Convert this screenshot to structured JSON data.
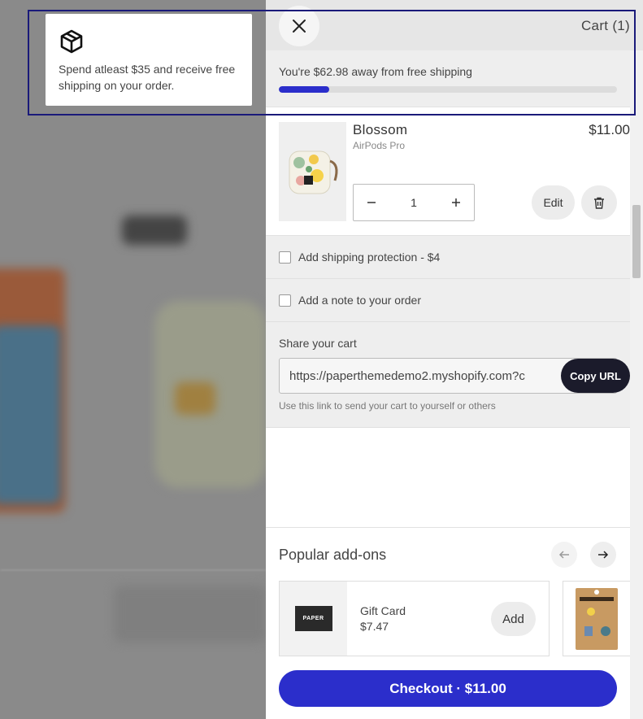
{
  "notice": {
    "icon": "package-icon",
    "text": "Spend atleast $35 and receive free shipping on your order."
  },
  "cart": {
    "title": "Cart (1)",
    "close_icon": "close-icon",
    "shipping_message": "You're $62.98 away from free shipping",
    "shipping_progress_percent": 15
  },
  "item": {
    "name": "Blossom",
    "variant": "AirPods Pro",
    "price": "$11.00",
    "quantity": "1",
    "edit_label": "Edit"
  },
  "options": {
    "shipping_protection": "Add shipping protection - $4",
    "order_note": "Add a note to your order"
  },
  "share": {
    "title": "Share your cart",
    "url": "https://paperthemedemo2.myshopify.com?c",
    "copy_label": "Copy URL",
    "help": "Use this link to send your cart to yourself or others"
  },
  "addons": {
    "title": "Popular add-ons",
    "items": [
      {
        "logo": "PAPER",
        "name": "Gift Card",
        "price": "$7.47",
        "add_label": "Add"
      }
    ]
  },
  "checkout": {
    "label": "Checkout · $11.00"
  },
  "colors": {
    "accent": "#2b2ecb",
    "dark_button": "#1b1b2b"
  }
}
